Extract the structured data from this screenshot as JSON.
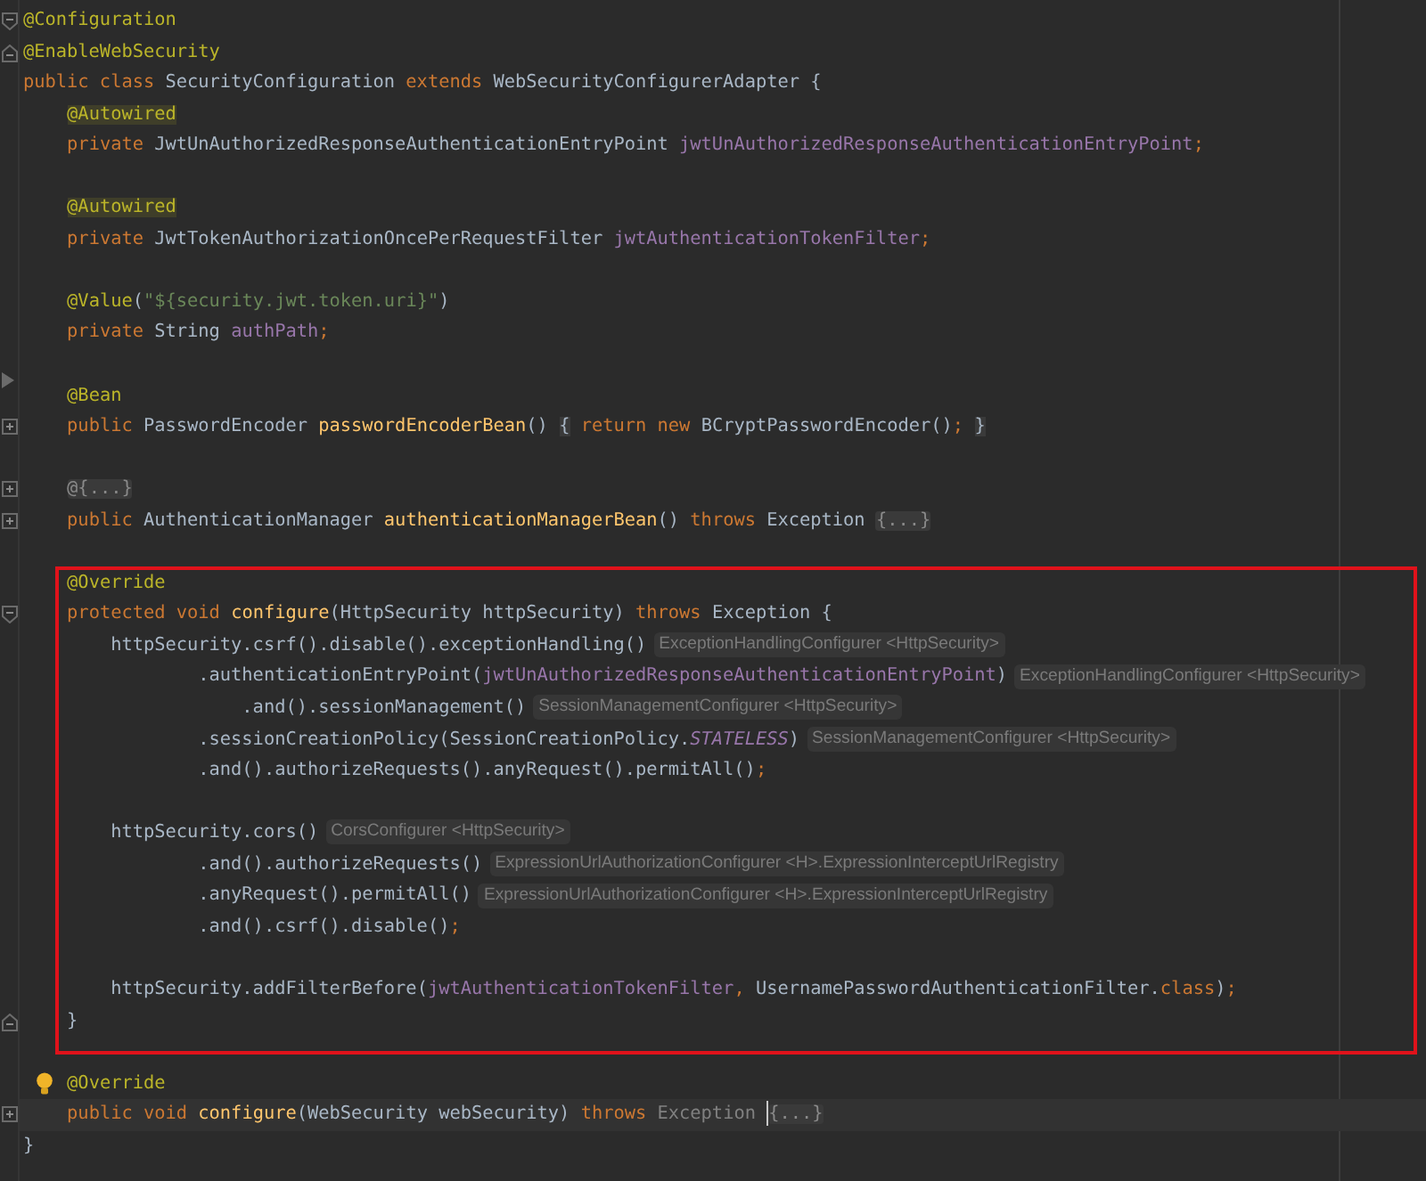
{
  "editor": {
    "sections": [
      {
        "kind": "plain",
        "lines": [
          {
            "kind": "code",
            "gutter": {
              "kind": "fold_open"
            },
            "parts": [
              {
                "kind": "annotation",
                "text": "@Configuration"
              }
            ]
          },
          {
            "kind": "code",
            "gutter": {
              "kind": "fold_close"
            },
            "parts": [
              {
                "kind": "annotation",
                "text": "@EnableWebSecurity"
              }
            ]
          },
          {
            "kind": "code",
            "parts": [
              {
                "kind": "keyword",
                "text": "public class "
              },
              {
                "kind": "plain",
                "text": "SecurityConfiguration "
              },
              {
                "kind": "keyword",
                "text": "extends "
              },
              {
                "kind": "plain",
                "text": "WebSecurityConfigurerAdapter {"
              }
            ]
          },
          {
            "kind": "code",
            "parts": [
              {
                "kind": "annotation_marked",
                "text": "    @Autowired"
              }
            ]
          },
          {
            "kind": "code",
            "parts": [
              {
                "kind": "keyword",
                "text": "    private "
              },
              {
                "kind": "plain",
                "text": "JwtUnAuthorizedResponseAuthenticationEntryPoint "
              },
              {
                "kind": "field",
                "text": "jwtUnAuthorizedResponseAuthenticationEntryPoint"
              },
              {
                "kind": "keyword",
                "text": ";"
              }
            ]
          },
          {
            "kind": "blank"
          },
          {
            "kind": "code",
            "parts": [
              {
                "kind": "annotation_marked",
                "text": "    @Autowired"
              }
            ]
          },
          {
            "kind": "code",
            "parts": [
              {
                "kind": "keyword",
                "text": "    private "
              },
              {
                "kind": "plain",
                "text": "JwtTokenAuthorizationOncePerRequestFilter "
              },
              {
                "kind": "field",
                "text": "jwtAuthenticationTokenFilter"
              },
              {
                "kind": "keyword",
                "text": ";"
              }
            ]
          },
          {
            "kind": "blank"
          },
          {
            "kind": "code",
            "parts": [
              {
                "kind": "annotation",
                "text": "    @Value"
              },
              {
                "kind": "plain",
                "text": "("
              },
              {
                "kind": "string",
                "text": "\"${security.jwt.token.uri}\""
              },
              {
                "kind": "plain",
                "text": ")"
              }
            ]
          },
          {
            "kind": "code",
            "parts": [
              {
                "kind": "keyword",
                "text": "    private "
              },
              {
                "kind": "plain",
                "text": "String "
              },
              {
                "kind": "field",
                "text": "authPath"
              },
              {
                "kind": "keyword",
                "text": ";"
              }
            ]
          },
          {
            "kind": "blank",
            "gutter": {
              "kind": "arrow"
            }
          },
          {
            "kind": "code",
            "parts": [
              {
                "kind": "annotation",
                "text": "    @Bean"
              }
            ]
          },
          {
            "kind": "code",
            "gutter": {
              "kind": "collapsed"
            },
            "parts": [
              {
                "kind": "keyword",
                "text": "    public "
              },
              {
                "kind": "plain",
                "text": "PasswordEncoder "
              },
              {
                "kind": "method",
                "text": "passwordEncoderBean"
              },
              {
                "kind": "plain",
                "text": "() "
              },
              {
                "kind": "brace",
                "text": "{"
              },
              {
                "kind": "keyword",
                "text": " return new "
              },
              {
                "kind": "plain",
                "text": "BCryptPasswordEncoder()"
              },
              {
                "kind": "keyword",
                "text": "; "
              },
              {
                "kind": "brace",
                "text": "}"
              }
            ]
          },
          {
            "kind": "blank"
          },
          {
            "kind": "code",
            "gutter": {
              "kind": "collapsed"
            },
            "parts": [
              {
                "kind": "fold",
                "text": "    @{...}"
              }
            ]
          },
          {
            "kind": "code",
            "gutter": {
              "kind": "collapsed"
            },
            "parts": [
              {
                "kind": "keyword",
                "text": "    public "
              },
              {
                "kind": "plain",
                "text": "AuthenticationManager "
              },
              {
                "kind": "method",
                "text": "authenticationManagerBean"
              },
              {
                "kind": "plain",
                "text": "() "
              },
              {
                "kind": "keyword",
                "text": "throws "
              },
              {
                "kind": "plain",
                "text": "Exception "
              },
              {
                "kind": "fold",
                "text": "{...}"
              }
            ]
          },
          {
            "kind": "blank"
          }
        ]
      },
      {
        "kind": "highlighted",
        "lines": [
          {
            "kind": "code",
            "parts": [
              {
                "kind": "annotation",
                "text": "    @Override"
              }
            ]
          },
          {
            "kind": "code",
            "gutter": {
              "kind": "fold_open"
            },
            "parts": [
              {
                "kind": "keyword",
                "text": "    protected void "
              },
              {
                "kind": "method",
                "text": "configure"
              },
              {
                "kind": "plain",
                "text": "(HttpSecurity httpSecurity) "
              },
              {
                "kind": "keyword",
                "text": "throws "
              },
              {
                "kind": "plain",
                "text": "Exception {"
              }
            ]
          },
          {
            "kind": "code",
            "parts": [
              {
                "kind": "plain",
                "text": "        httpSecurity.csrf().disable().exceptionHandling()"
              },
              {
                "kind": "hint",
                "text": "ExceptionHandlingConfigurer <HttpSecurity>"
              }
            ]
          },
          {
            "kind": "code",
            "parts": [
              {
                "kind": "plain",
                "text": "                .authenticationEntryPoint("
              },
              {
                "kind": "field",
                "text": "jwtUnAuthorizedResponseAuthenticationEntryPoint"
              },
              {
                "kind": "plain",
                "text": ")"
              },
              {
                "kind": "hint",
                "text": "ExceptionHandlingConfigurer <HttpSecurity>"
              }
            ]
          },
          {
            "kind": "code",
            "parts": [
              {
                "kind": "plain",
                "text": "                    .and().sessionManagement()"
              },
              {
                "kind": "hint",
                "text": "SessionManagementConfigurer <HttpSecurity>"
              }
            ]
          },
          {
            "kind": "code",
            "parts": [
              {
                "kind": "plain",
                "text": "                .sessionCreationPolicy(SessionCreationPolicy."
              },
              {
                "kind": "constant",
                "text": "STATELESS"
              },
              {
                "kind": "plain",
                "text": ")"
              },
              {
                "kind": "hint",
                "text": "SessionManagementConfigurer <HttpSecurity>"
              }
            ]
          },
          {
            "kind": "code",
            "parts": [
              {
                "kind": "plain",
                "text": "                .and().authorizeRequests().anyRequest().permitAll()"
              },
              {
                "kind": "keyword",
                "text": ";"
              }
            ]
          },
          {
            "kind": "blank"
          },
          {
            "kind": "code",
            "parts": [
              {
                "kind": "plain",
                "text": "        httpSecurity.cors()"
              },
              {
                "kind": "hint",
                "text": "CorsConfigurer <HttpSecurity>"
              }
            ]
          },
          {
            "kind": "code",
            "parts": [
              {
                "kind": "plain",
                "text": "                .and().authorizeRequests()"
              },
              {
                "kind": "hint",
                "text": "ExpressionUrlAuthorizationConfigurer <H>.ExpressionInterceptUrlRegistry"
              }
            ]
          },
          {
            "kind": "code",
            "parts": [
              {
                "kind": "plain",
                "text": "                .anyRequest().permitAll()"
              },
              {
                "kind": "hint",
                "text": "ExpressionUrlAuthorizationConfigurer <H>.ExpressionInterceptUrlRegistry"
              }
            ]
          },
          {
            "kind": "code",
            "parts": [
              {
                "kind": "plain",
                "text": "                .and().csrf().disable()"
              },
              {
                "kind": "keyword",
                "text": ";"
              }
            ]
          },
          {
            "kind": "blank"
          },
          {
            "kind": "code",
            "parts": [
              {
                "kind": "plain",
                "text": "        httpSecurity.addFilterBefore("
              },
              {
                "kind": "field",
                "text": "jwtAuthenticationTokenFilter"
              },
              {
                "kind": "keyword",
                "text": ", "
              },
              {
                "kind": "plain",
                "text": "UsernamePasswordAuthenticationFilter."
              },
              {
                "kind": "keyword",
                "text": "class"
              },
              {
                "kind": "plain",
                "text": ")"
              },
              {
                "kind": "keyword",
                "text": ";"
              }
            ]
          },
          {
            "kind": "code",
            "gutter": {
              "kind": "fold_close"
            },
            "parts": [
              {
                "kind": "plain",
                "text": "    }"
              }
            ]
          }
        ]
      },
      {
        "kind": "plain",
        "lines": [
          {
            "kind": "blank"
          },
          {
            "kind": "code",
            "gutter": {
              "kind": "bulb"
            },
            "parts": [
              {
                "kind": "annotation",
                "text": "    @Override"
              }
            ]
          },
          {
            "kind": "code",
            "current": true,
            "gutter": {
              "kind": "collapsed"
            },
            "parts": [
              {
                "kind": "keyword",
                "text": "    public void "
              },
              {
                "kind": "method",
                "text": "configure"
              },
              {
                "kind": "plain",
                "text": "(WebSecurity webSecurity) "
              },
              {
                "kind": "keyword",
                "text": "throws "
              },
              {
                "kind": "dim",
                "text": "Exception "
              },
              {
                "kind": "caret"
              },
              {
                "kind": "fold",
                "text": "{...}"
              }
            ]
          },
          {
            "kind": "code",
            "parts": [
              {
                "kind": "plain",
                "text": "}"
              }
            ]
          }
        ]
      }
    ]
  }
}
